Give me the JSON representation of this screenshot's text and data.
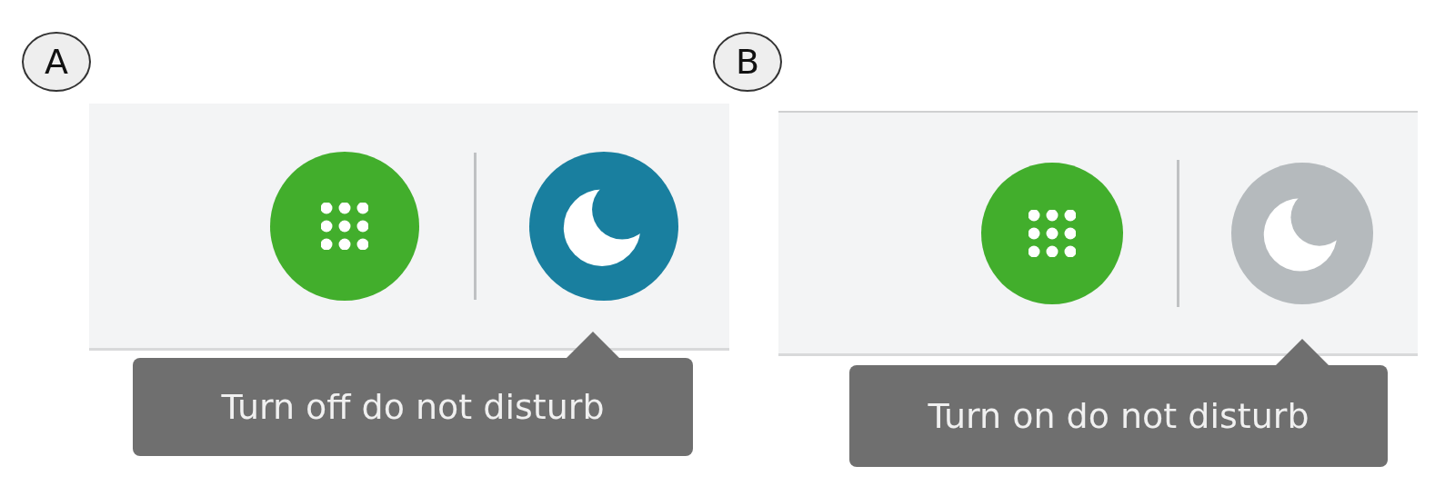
{
  "panels": [
    {
      "label": "A",
      "do_not_disturb": {
        "on": true
      },
      "tooltip": "Turn off do not disturb"
    },
    {
      "label": "B",
      "do_not_disturb": {
        "on": false
      },
      "tooltip": "Turn on do not disturb"
    }
  ]
}
